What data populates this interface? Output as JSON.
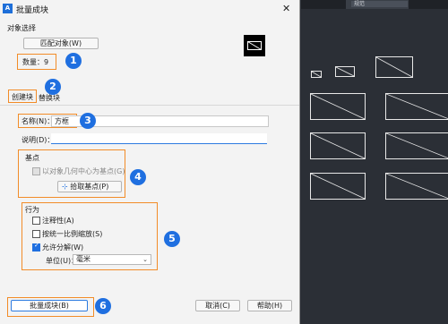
{
  "dialog": {
    "title": "批量成块",
    "close_glyph": "✕",
    "icon_text": "A"
  },
  "object_section": {
    "label": "对象选择",
    "match_button": "匹配对象(W)",
    "count_label": "数量：9"
  },
  "tabs": {
    "create": "创建块",
    "replace": "替换块"
  },
  "name_field": {
    "label": "名称(N)：",
    "value": "方框"
  },
  "desc_field": {
    "label": "说明(D)：",
    "value": ""
  },
  "base_point": {
    "label": "基点",
    "center_checkbox": "以对象几何中心为基点(G)",
    "pick_button": "拾取基点(P)"
  },
  "behavior": {
    "label": "行为",
    "annotative": "注释性(A)",
    "uniform_scale": "按统一比例缩放(S)",
    "allow_explode": "允许分解(W)",
    "unit_label": "单位(U)：",
    "unit_value": "毫米"
  },
  "footer": {
    "batch_button": "批量成块(B)",
    "cancel_button": "取消(C)",
    "help_button": "帮助(H)"
  },
  "badges": [
    "1",
    "2",
    "3",
    "4",
    "5",
    "6"
  ],
  "cad": {
    "field_text": "规范"
  },
  "colors": {
    "accent": "#1f6fe0",
    "highlight": "#f28c28",
    "cad_background": "#2b2f36"
  }
}
